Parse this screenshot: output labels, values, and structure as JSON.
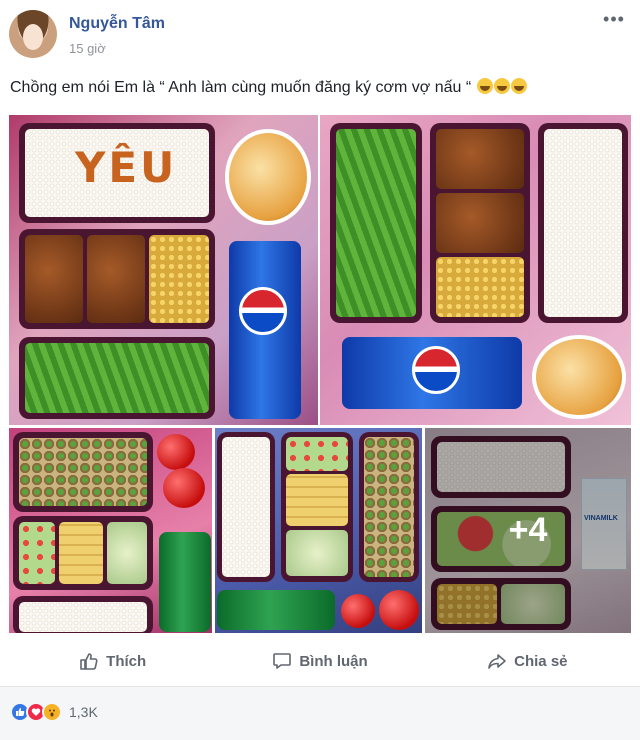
{
  "post": {
    "author": "Nguyễn Tâm",
    "timestamp": "15 giờ",
    "caption": "Chồng em nói Em là “ Anh làm cùng muốn đăng ký cơm vợ nấu “",
    "caption_emojis": [
      "grinning-face",
      "grinning-face",
      "grinning-face"
    ]
  },
  "photos": {
    "count_overlay": "+4",
    "rice_text": "YÊU",
    "can_brand": "pepsi",
    "milk_brand": "VINAMILK"
  },
  "actions": {
    "like": "Thích",
    "comment": "Bình luận",
    "share": "Chia sẻ"
  },
  "reactions": {
    "types": [
      "like",
      "love",
      "wow"
    ],
    "count": "1,3K"
  },
  "colors": {
    "link_blue": "#365899",
    "muted": "#90949c",
    "like_blue": "#3578e5",
    "love_red": "#f0284a",
    "wow_yellow": "#f7b125"
  }
}
